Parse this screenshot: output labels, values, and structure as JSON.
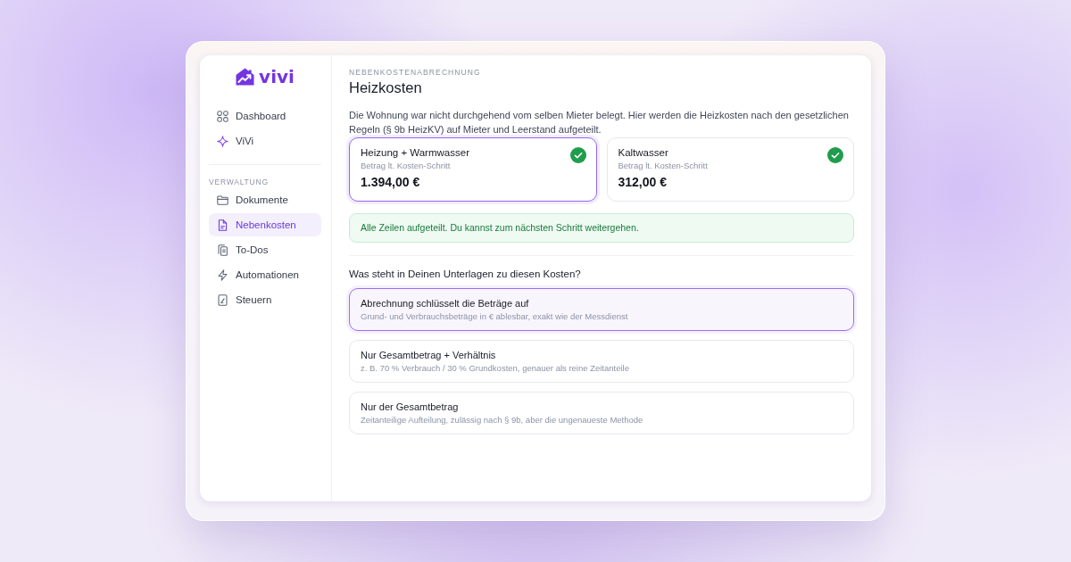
{
  "sidebar": {
    "logo": "vivi",
    "items": [
      {
        "label": "Dashboard",
        "selected": false
      },
      {
        "label": "ViVi",
        "selected": false
      }
    ],
    "section": {
      "heading": "VERWALTUNG",
      "items": [
        {
          "label": "Dokumente",
          "selected": false
        },
        {
          "label": "Nebenkosten",
          "selected": true
        },
        {
          "label": "To-Dos",
          "selected": false
        },
        {
          "label": "Automationen",
          "selected": false
        },
        {
          "label": "Steuern",
          "selected": false
        }
      ]
    }
  },
  "header": {
    "eyebrow": "NEBENKOSTENABRECHNUNG",
    "title": "Heizkosten",
    "description": "Die Wohnung war nicht durchgehend vom selben Mieter belegt. Hier werden die Heizkosten nach den gesetzlichen Regeln (§ 9b HeizKV) auf Mieter und Leerstand aufgeteilt."
  },
  "cost_cards": [
    {
      "title": "Heizung + Warmwasser",
      "subtitle": "Betrag lt. Kosten-Schritt",
      "amount": "1.394,00 €",
      "selected": true,
      "done": true
    },
    {
      "title": "Kaltwasser",
      "subtitle": "Betrag lt. Kosten-Schritt",
      "amount": "312,00 €",
      "selected": false,
      "done": true
    }
  ],
  "notice": "Alle Zeilen aufgeteilt. Du kannst zum nächsten Schritt weitergehen.",
  "question": {
    "text": "Was steht in Deinen Unterlagen zu diesen Kosten?",
    "options": [
      {
        "title": "Abrechnung schlüsselt die Beträge auf",
        "description": "Grund- und Verbrauchsbeträge in € ablesbar, exakt wie der Messdienst",
        "selected": true
      },
      {
        "title": "Nur Gesamtbetrag + Verhältnis",
        "description": "z. B. 70 % Verbrauch / 30 % Grundkosten, genauer als reine Zeitanteile",
        "selected": false
      },
      {
        "title": "Nur der Gesamtbetrag",
        "description": "Zeitanteilige Aufteilung, zulässig nach § 9b, aber die ungenaueste Methode",
        "selected": false
      }
    ]
  }
}
